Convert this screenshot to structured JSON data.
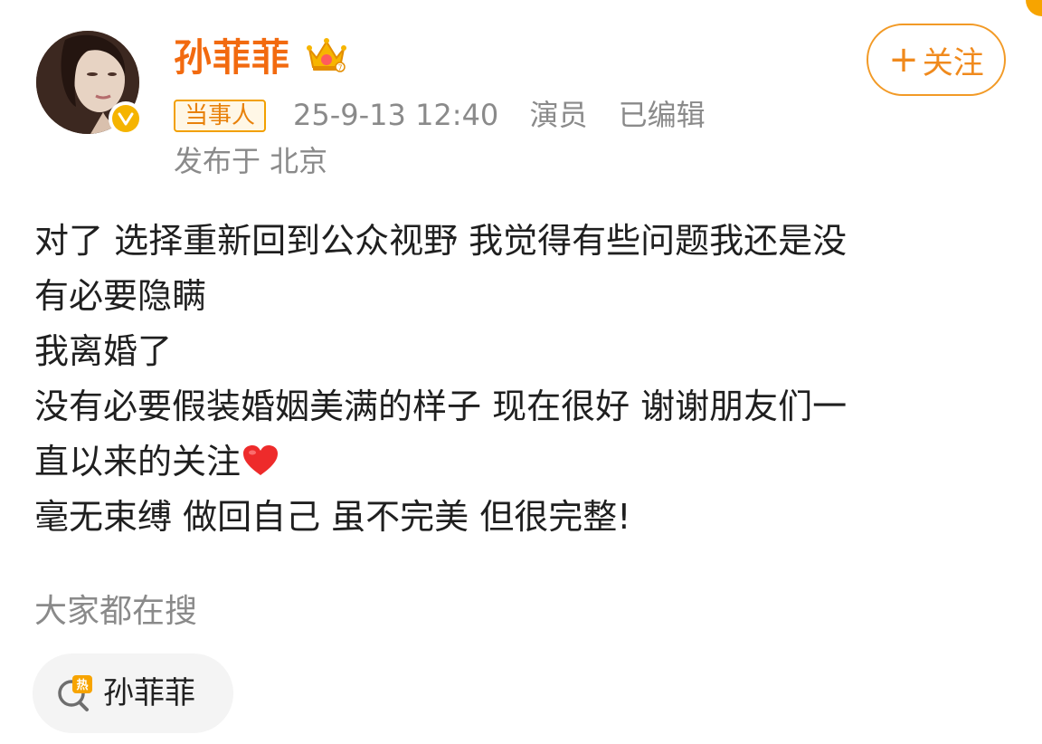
{
  "user": {
    "name": "孙菲菲",
    "badge_tag": "当事人",
    "timestamp": "25-9-13 12:40",
    "occupation": "演员",
    "edited": "已编辑",
    "location": "发布于 北京",
    "avatar_icon": "user-avatar",
    "verified_icon": "verified-v-icon",
    "crown_icon": "crown-icon"
  },
  "follow_button": {
    "label": "关注",
    "icon": "plus-icon"
  },
  "post": {
    "lines": [
      "对了 选择重新回到公众视野 我觉得有些问题我还是没",
      "有必要隐瞒",
      "我离婚了",
      "没有必要假装婚姻美满的样子 现在很好 谢谢朋友们一",
      "直以来的关注",
      "毫无束缚 做回自己 虽不完美 但很完整!"
    ],
    "emoji": "red-heart-icon"
  },
  "search": {
    "heading": "大家都在搜",
    "chips": [
      {
        "label": "孙菲菲",
        "icon": "hot-search-icon"
      }
    ]
  },
  "colors": {
    "accent": "#f26a0f",
    "follow": "#f08a1d",
    "meta": "#8a8a8a",
    "text": "#1f1f1f"
  }
}
